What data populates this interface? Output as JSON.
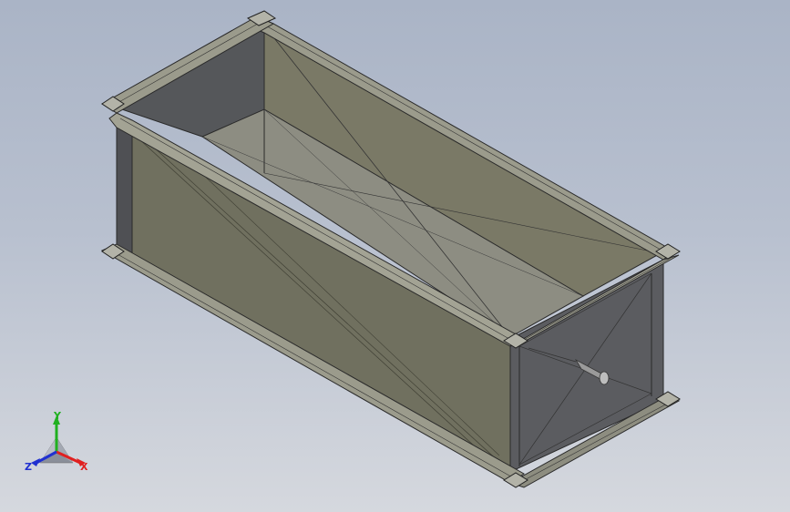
{
  "viewport": {
    "background_top": "#aab4c6",
    "background_bottom": "#d5d8de",
    "model": "rectangular-duct-section-with-flanges"
  },
  "triad": {
    "x_label": "X",
    "y_label": "Y",
    "z_label": "Z",
    "x_color": "#e02020",
    "y_color": "#20b020",
    "z_color": "#2030d0"
  }
}
